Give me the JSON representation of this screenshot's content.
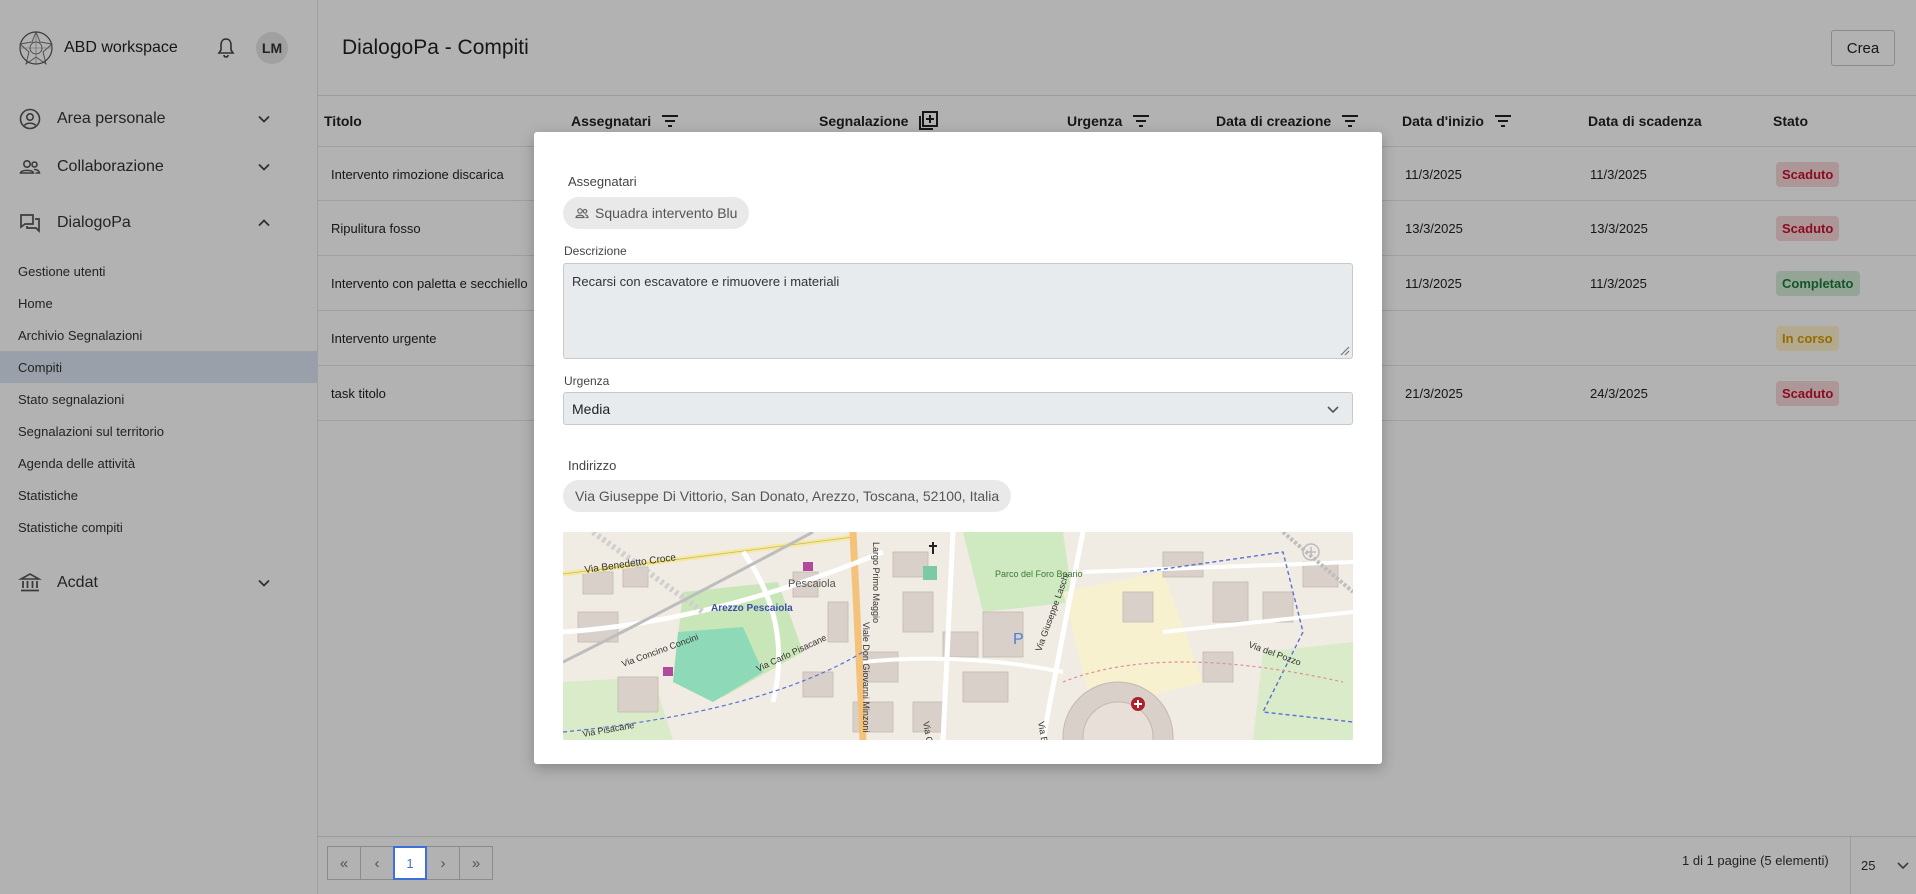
{
  "app": {
    "name": "ABD workspace",
    "user_initials": "LM"
  },
  "sidebar": {
    "groups": [
      {
        "label": "Area personale",
        "icon": "person-circle-icon",
        "expanded": false
      },
      {
        "label": "Collaborazione",
        "icon": "people-icon",
        "expanded": false
      },
      {
        "label": "DialogoPa",
        "icon": "chat-icon",
        "expanded": true
      },
      {
        "label": "Acdat",
        "icon": "bank-icon",
        "expanded": false
      }
    ],
    "dialogopa_items": [
      {
        "label": "Gestione utenti"
      },
      {
        "label": "Home"
      },
      {
        "label": "Archivio Segnalazioni"
      },
      {
        "label": "Compiti",
        "active": true
      },
      {
        "label": "Stato segnalazioni"
      },
      {
        "label": "Segnalazioni sul territorio"
      },
      {
        "label": "Agenda delle attività"
      },
      {
        "label": "Statistiche"
      },
      {
        "label": "Statistiche compiti"
      }
    ]
  },
  "header": {
    "title": "DialogoPa - Compiti",
    "create_label": "Crea"
  },
  "table": {
    "columns": [
      "Titolo",
      "Assegnatari",
      "Segnalazione",
      "Urgenza",
      "Data di creazione",
      "Data d'inizio",
      "Data di scadenza",
      "Stato"
    ],
    "rows": [
      {
        "title": "Intervento rimozione discarica",
        "start": "11/3/2025",
        "due": "11/3/2025",
        "status": "Scaduto"
      },
      {
        "title": "Ripulitura fosso",
        "start": "13/3/2025",
        "due": "13/3/2025",
        "status": "Scaduto"
      },
      {
        "title": "Intervento con paletta e secchiello",
        "start": "11/3/2025",
        "due": "11/3/2025",
        "status": "Completato"
      },
      {
        "title": "Intervento urgente",
        "start": "",
        "due": "",
        "status": "In corso"
      },
      {
        "title": "task titolo",
        "start": "21/3/2025",
        "due": "24/3/2025",
        "status": "Scaduto"
      }
    ],
    "status_colors": {
      "Scaduto": {
        "fg": "#c8102e",
        "bg": "#f8d7da"
      },
      "Completato": {
        "fg": "#1e7a3a",
        "bg": "#d4edda"
      },
      "In corso": {
        "fg": "#d49b00",
        "bg": "#fff3cd"
      }
    }
  },
  "pagination": {
    "first": "«",
    "prev": "‹",
    "current": "1",
    "next": "›",
    "last": "»",
    "info": "1 di 1 pagine (5 elementi)",
    "per_page": "25"
  },
  "modal": {
    "assignees_label": "Assegnatari",
    "assignee_chip": "Squadra intervento Blu",
    "description_label": "Descrizione",
    "description_value": "Recarsi con escavatore e rimuovere i materiali",
    "urgency_label": "Urgenza",
    "urgency_value": "Media",
    "address_label": "Indirizzo",
    "address_value": "Via Giuseppe Di Vittorio, San Donato, Arezzo, Toscana, 52100, Italia",
    "map_labels": {
      "street1": "Via Benedetto Croce",
      "station": "Arezzo Pescaiola",
      "area": "Pescaiola",
      "street2": "Via Concino Concini",
      "street3": "Via Carlo Pisacane",
      "street4": "Viale Don Giovanni Minzoni",
      "street5": "Largo Primo Maggio",
      "park": "Parco del Foro Boario",
      "street6": "Via Giuseppe Laschi",
      "street7": "Via del Pozzo",
      "parking": "P",
      "street8": "Via Pisacane",
      "street9": "Via Guido Monaco",
      "street10": "Via Enrico Nenni"
    }
  }
}
